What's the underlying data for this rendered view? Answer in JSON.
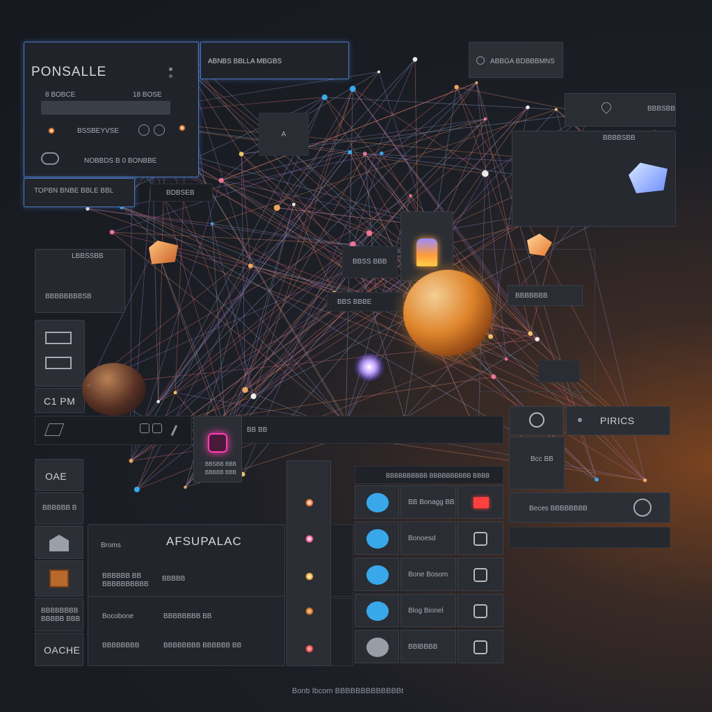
{
  "top": {
    "panel1_title": "PONSALLE",
    "panel1_row1_a": "8 BOBCE",
    "panel1_row1_b": "18 BOSE",
    "panel1_row2": "BSSBEYVSE",
    "panel1_row3": "NOBBDS B 0 BONBBE",
    "panel1_footer": "TOPBN BNBE BBLE BBL",
    "panel1_footer2": "BDBSEB",
    "panel2_title": "ABNBS BBLLA MBGBS",
    "btn_a": "A",
    "panel3_title": "ABBGA BDBBBMNS"
  },
  "right_top": {
    "row1": "BBBSBB",
    "row2": "BBBBSBB"
  },
  "middle": {
    "left_row1": "LBBSSBB",
    "left_row2": "BBBBBBBBSB",
    "center_a": "BBSS BBB",
    "center_b": "BBS BBBE",
    "right_row": "BBBBBBB",
    "left_tile_label": "C1 PM",
    "bottom_tab": "BB BB",
    "pink_label_1": "BBSBB BBB",
    "pink_label_2": "BBBBB BBB"
  },
  "pirics": {
    "title": "PIRICS",
    "row1": "Bcc BB",
    "row2": "Beces BBBBBBBB"
  },
  "bottom_left": {
    "title": "OAE",
    "row1": "BBBBBB B",
    "row2_a": "BBBBBBBB",
    "row2_b": "BBBBB BBB",
    "footer": "OACHE",
    "main_title": "AFSUPALAC",
    "main_sub": "Broms",
    "col_a1": "BBBBBB BB",
    "col_a2": "BBBBBBBBBB",
    "col_b1": "BBBBB",
    "col_c1": "Bocobone",
    "col_c2": "BBBBBBBB BB",
    "col_d1": "BBBBBBBB",
    "col_d2": "BBBBBBBB BBBBBB BB"
  },
  "list": {
    "header": "BBBBBBBBBB BBBBBBBBBB BBBB",
    "items": [
      "BB Bonagg BB",
      "Bonoesd",
      "Bone Bosom",
      "Blog Bionel",
      "BBlBBBB"
    ]
  },
  "footer": {
    "caption": "Bonb Ibcom BBBBBBBBBBBBBt"
  },
  "colors": {
    "accent_blue": "#4a78c4",
    "accent_orange": "#e88a2c",
    "accent_pink": "#ff3db0",
    "accent_cyan": "#3ab6ff"
  }
}
